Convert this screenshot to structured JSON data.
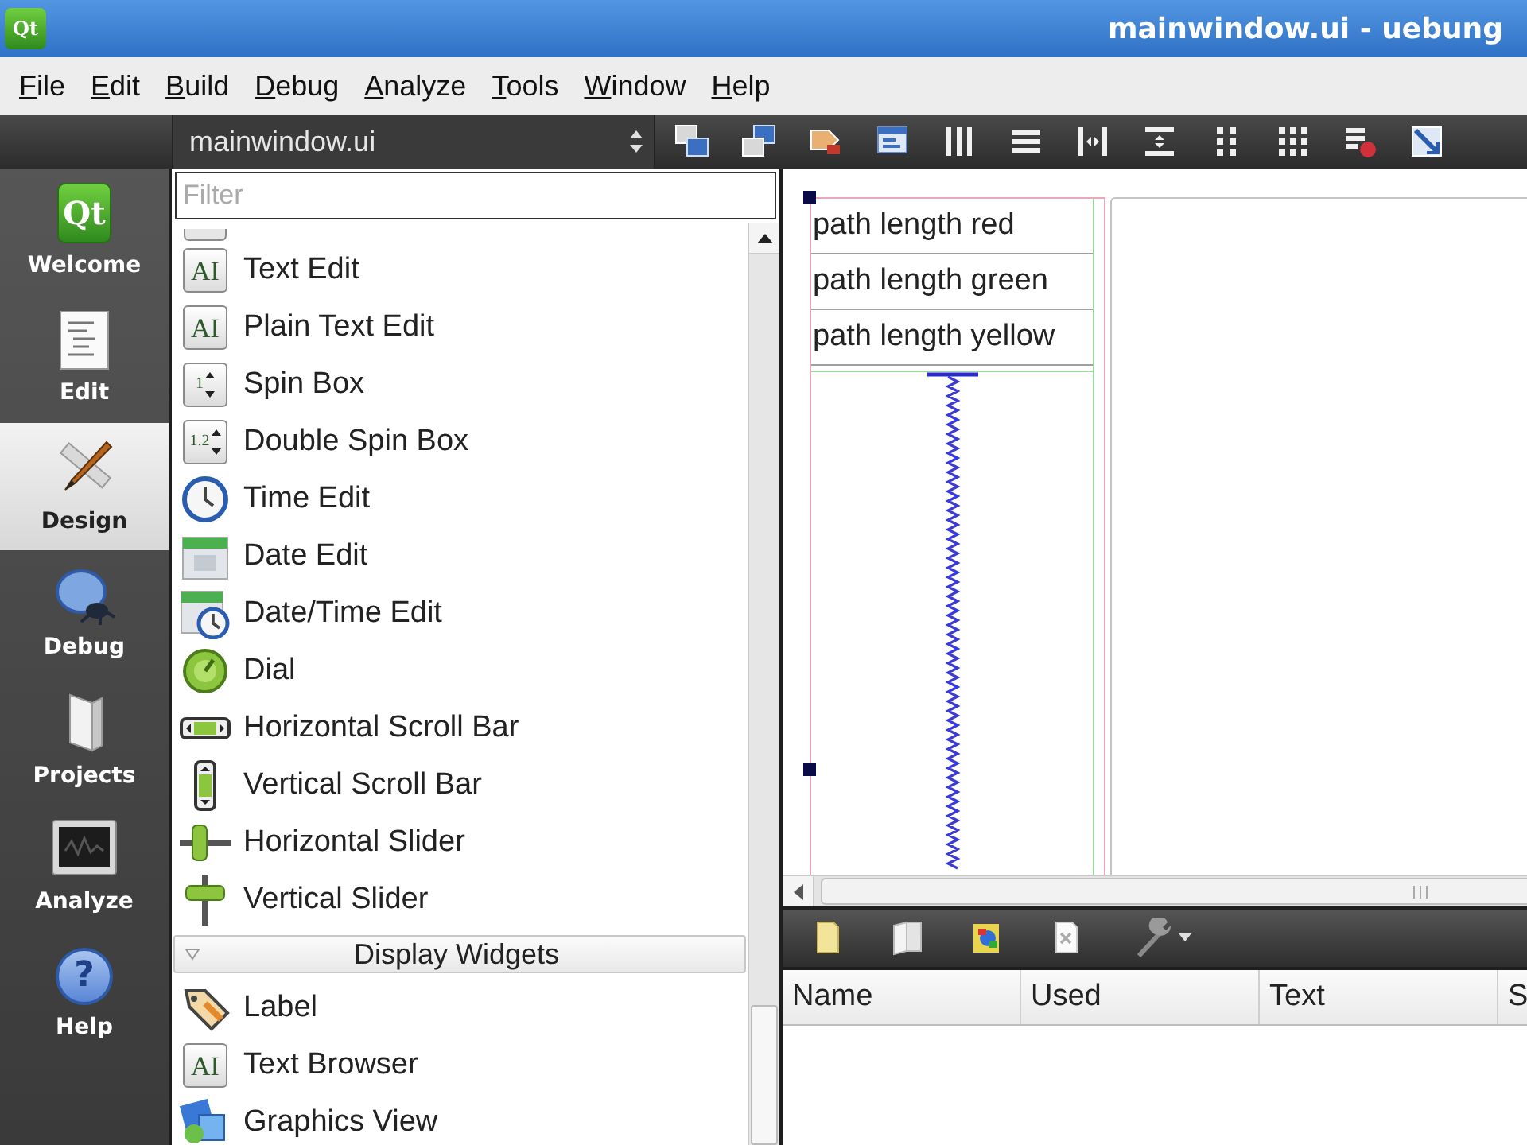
{
  "window": {
    "logo": "Qt",
    "title": "mainwindow.ui - uebung"
  },
  "menu_bar": [
    "File",
    "Edit",
    "Build",
    "Debug",
    "Analyze",
    "Tools",
    "Window",
    "Help"
  ],
  "toolbar": {
    "document": "mainwindow.ui"
  },
  "mode_bar": [
    {
      "label": "Welcome",
      "glyph": "Qt",
      "selected": false
    },
    {
      "label": "Edit",
      "selected": false
    },
    {
      "label": "Design",
      "selected": true
    },
    {
      "label": "Debug",
      "selected": false
    },
    {
      "label": "Projects",
      "selected": false
    },
    {
      "label": "Analyze",
      "selected": false
    },
    {
      "label": "Help",
      "glyph": "?",
      "selected": false
    }
  ],
  "widget_box": {
    "filter": {
      "placeholder": "Filter"
    },
    "groups": [
      {
        "items": [
          {
            "label": "Text Edit",
            "glyph": "AI"
          },
          {
            "label": "Plain Text Edit",
            "glyph": "AI"
          },
          {
            "label": "Spin Box",
            "glyph": "1"
          },
          {
            "label": "Double Spin Box",
            "glyph": "1.2"
          },
          {
            "label": "Time Edit"
          },
          {
            "label": "Date Edit"
          },
          {
            "label": "Date/Time Edit"
          },
          {
            "label": "Dial"
          },
          {
            "label": "Horizontal Scroll Bar"
          },
          {
            "label": "Vertical Scroll Bar"
          },
          {
            "label": "Horizontal Slider"
          },
          {
            "label": "Vertical Slider"
          }
        ]
      },
      {
        "title": "Display Widgets",
        "expanded": true,
        "items": [
          {
            "label": "Label"
          },
          {
            "label": "Text Browser",
            "glyph": "AI"
          },
          {
            "label": "Graphics View"
          }
        ]
      }
    ]
  },
  "form": {
    "labels": [
      "path length red",
      "path length green",
      "path length yellow"
    ]
  },
  "action_editor": {
    "columns": [
      "Name",
      "Used",
      "Text",
      "S"
    ]
  }
}
